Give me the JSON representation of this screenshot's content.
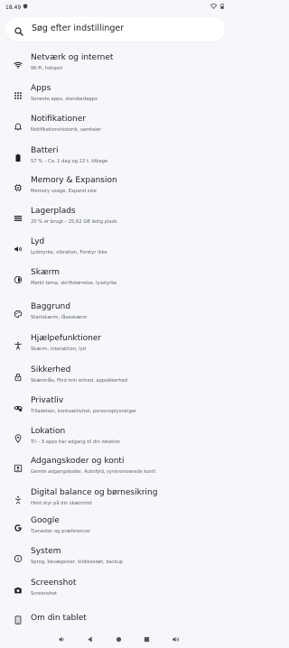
{
  "status_bar": {
    "time": "18.49"
  },
  "search": {
    "placeholder": "Søg efter indstillinger"
  },
  "settings": [
    {
      "title": "Netværk og internet",
      "subtitle": "Wi-Fi, hotspot",
      "icon": "wifi-icon"
    },
    {
      "title": "Apps",
      "subtitle": "Seneste apps, standardapps",
      "icon": "apps-grid-icon"
    },
    {
      "title": "Notifikationer",
      "subtitle": "Notifikationshistorik, samtaler",
      "icon": "bell-icon"
    },
    {
      "title": "Batteri",
      "subtitle": "57 % – Ca. 1 dag og 22 t. tilbage",
      "icon": "battery-icon"
    },
    {
      "title": "Memory & Expansion",
      "subtitle": "Memory usage, Expand size",
      "icon": "memory-chip-icon"
    },
    {
      "title": "Lagerplads",
      "subtitle": "20 % er brugt – 25,62 GB ledig plads",
      "icon": "storage-icon"
    },
    {
      "title": "Lyd",
      "subtitle": "Lydstyrke, vibration, Forstyr ikke",
      "icon": "volume-icon"
    },
    {
      "title": "Skærm",
      "subtitle": "Mørkt tema, skriftstørrelse, lysstyrke",
      "icon": "brightness-icon"
    },
    {
      "title": "Baggrund",
      "subtitle": "Startskærm, låseskærm",
      "icon": "palette-icon"
    },
    {
      "title": "Hjælpefunktioner",
      "subtitle": "Skærm, interaktion, lyd",
      "icon": "accessibility-icon"
    },
    {
      "title": "Sikkerhed",
      "subtitle": "Skærmlås, Find min enhed, appsikkerhed",
      "icon": "lock-icon"
    },
    {
      "title": "Privatliv",
      "subtitle": "Tilladelser, kontoaktivitet, personoplysninger",
      "icon": "privacy-eye-icon"
    },
    {
      "title": "Lokation",
      "subtitle": "Til – 3 apps har adgang til din lokation",
      "icon": "location-pin-icon"
    },
    {
      "title": "Adgangskoder og konti",
      "subtitle": "Gemte adgangskoder, Autofyld, synkroniserede konti",
      "icon": "account-box-icon"
    },
    {
      "title": "Digital balance og børnesikring",
      "subtitle": "Hold styr på din skærmtid",
      "icon": "wellbeing-icon"
    },
    {
      "title": "Google",
      "subtitle": "Tjenester og præferencer",
      "icon": "google-icon"
    },
    {
      "title": "System",
      "subtitle": "Sprog, bevægelser, klokkeslæt, backup",
      "icon": "info-icon"
    },
    {
      "title": "Screenshot",
      "subtitle": "Screenshot",
      "icon": "camera-icon"
    },
    {
      "title": "Om din tablet",
      "subtitle": "",
      "icon": "tablet-icon"
    }
  ]
}
